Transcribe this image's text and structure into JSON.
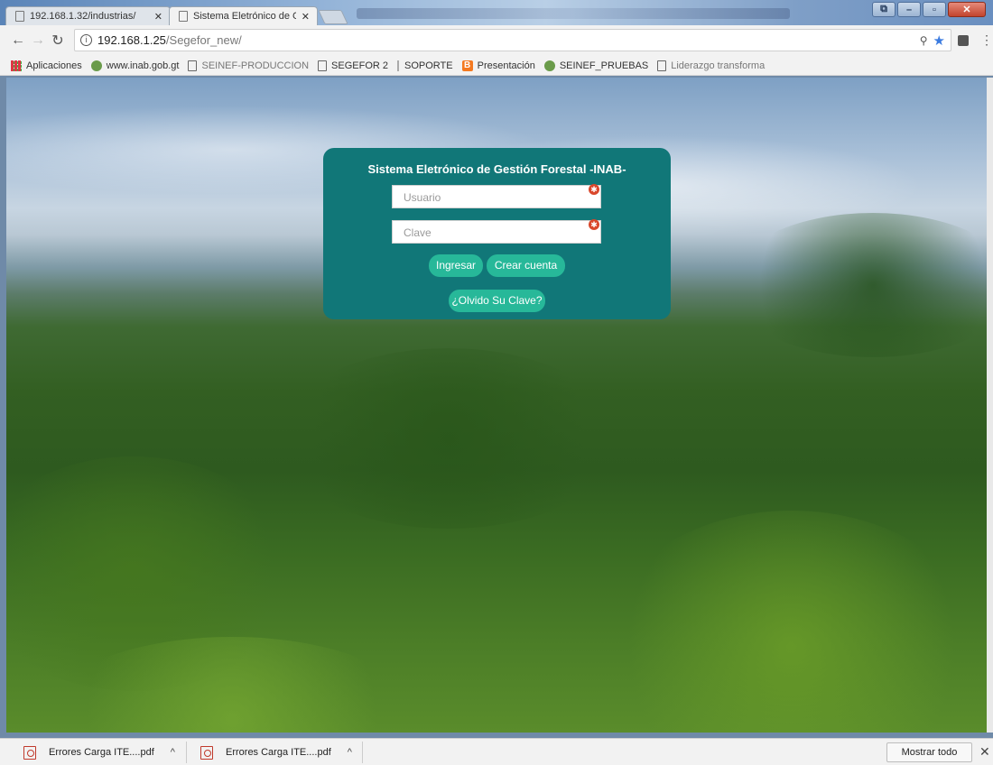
{
  "tabs": [
    {
      "title": "192.168.1.32/industrias/"
    },
    {
      "title": "Sistema Eletrónico de Ge"
    }
  ],
  "address": {
    "host": "192.168.1.25",
    "path": "/Segefor_new/"
  },
  "bookmarks": [
    {
      "label": "Aplicaciones",
      "icon": "apps-grid-icon"
    },
    {
      "label": "www.inab.gob.gt",
      "icon": "inab-icon"
    },
    {
      "label": "SEINEF-PRODUCCION",
      "icon": "page-icon"
    },
    {
      "label": "SEGEFOR 2",
      "icon": "page-icon"
    },
    {
      "label": "SOPORTE",
      "icon": "page-icon"
    },
    {
      "label": "Presentación",
      "icon": "blogger-icon"
    },
    {
      "label": "SEINEF_PRUEBAS",
      "icon": "inab-icon"
    },
    {
      "label": "Liderazgo transforma",
      "icon": "page-icon"
    }
  ],
  "login": {
    "title": "Sistema Eletrónico de Gestión Forestal -INAB-",
    "user_placeholder": "Usuario",
    "pass_placeholder": "Clave",
    "login_button": "Ingresar",
    "create_button": "Crear cuenta",
    "forgot_button": "¿Olvido Su Clave?"
  },
  "downloads": {
    "items": [
      {
        "name": "Errores Carga ITE....pdf"
      },
      {
        "name": "Errores Carga ITE....pdf"
      }
    ],
    "show_all": "Mostrar todo"
  },
  "colors": {
    "panel": "#117778",
    "button": "#27b899",
    "required": "#d9472b"
  }
}
